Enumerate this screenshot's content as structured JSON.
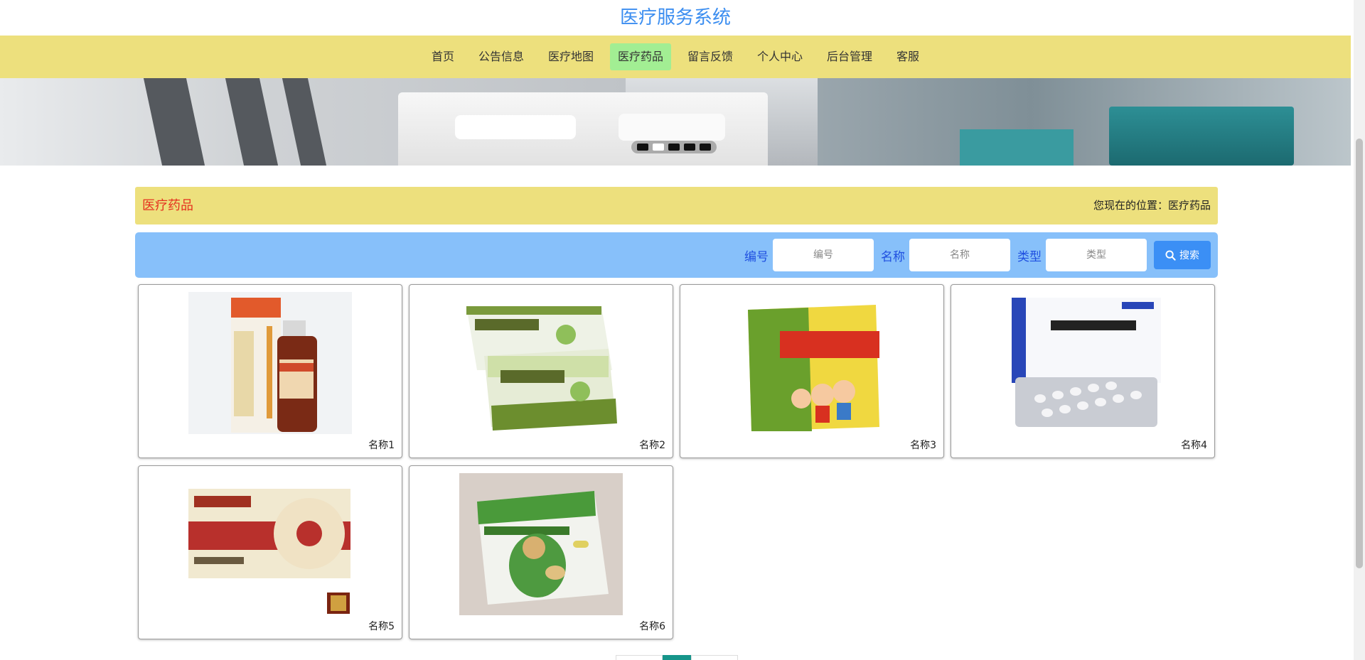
{
  "site": {
    "title": "医疗服务系统"
  },
  "nav": {
    "items": [
      {
        "label": "首页"
      },
      {
        "label": "公告信息"
      },
      {
        "label": "医疗地图"
      },
      {
        "label": "医疗药品",
        "active": true
      },
      {
        "label": "留言反馈"
      },
      {
        "label": "个人中心"
      },
      {
        "label": "后台管理"
      },
      {
        "label": "客服"
      }
    ],
    "active_color": "#a2ee93",
    "bar_color": "#ede07d"
  },
  "banner": {
    "slide_count": 5,
    "active_index": 1
  },
  "breadcrumb": {
    "title": "医疗药品",
    "location": "您现在的位置：医疗药品"
  },
  "search": {
    "fields": [
      {
        "label": "编号",
        "placeholder": "编号"
      },
      {
        "label": "名称",
        "placeholder": "名称"
      },
      {
        "label": "类型",
        "placeholder": "类型"
      }
    ],
    "button_label": "搜索",
    "button_icon": "search-icon"
  },
  "products": [
    {
      "name": "名称1"
    },
    {
      "name": "名称2"
    },
    {
      "name": "名称3"
    },
    {
      "name": "名称4"
    },
    {
      "name": "名称5"
    },
    {
      "name": "名称6"
    }
  ],
  "pagination": {
    "active_page_index": 1
  }
}
